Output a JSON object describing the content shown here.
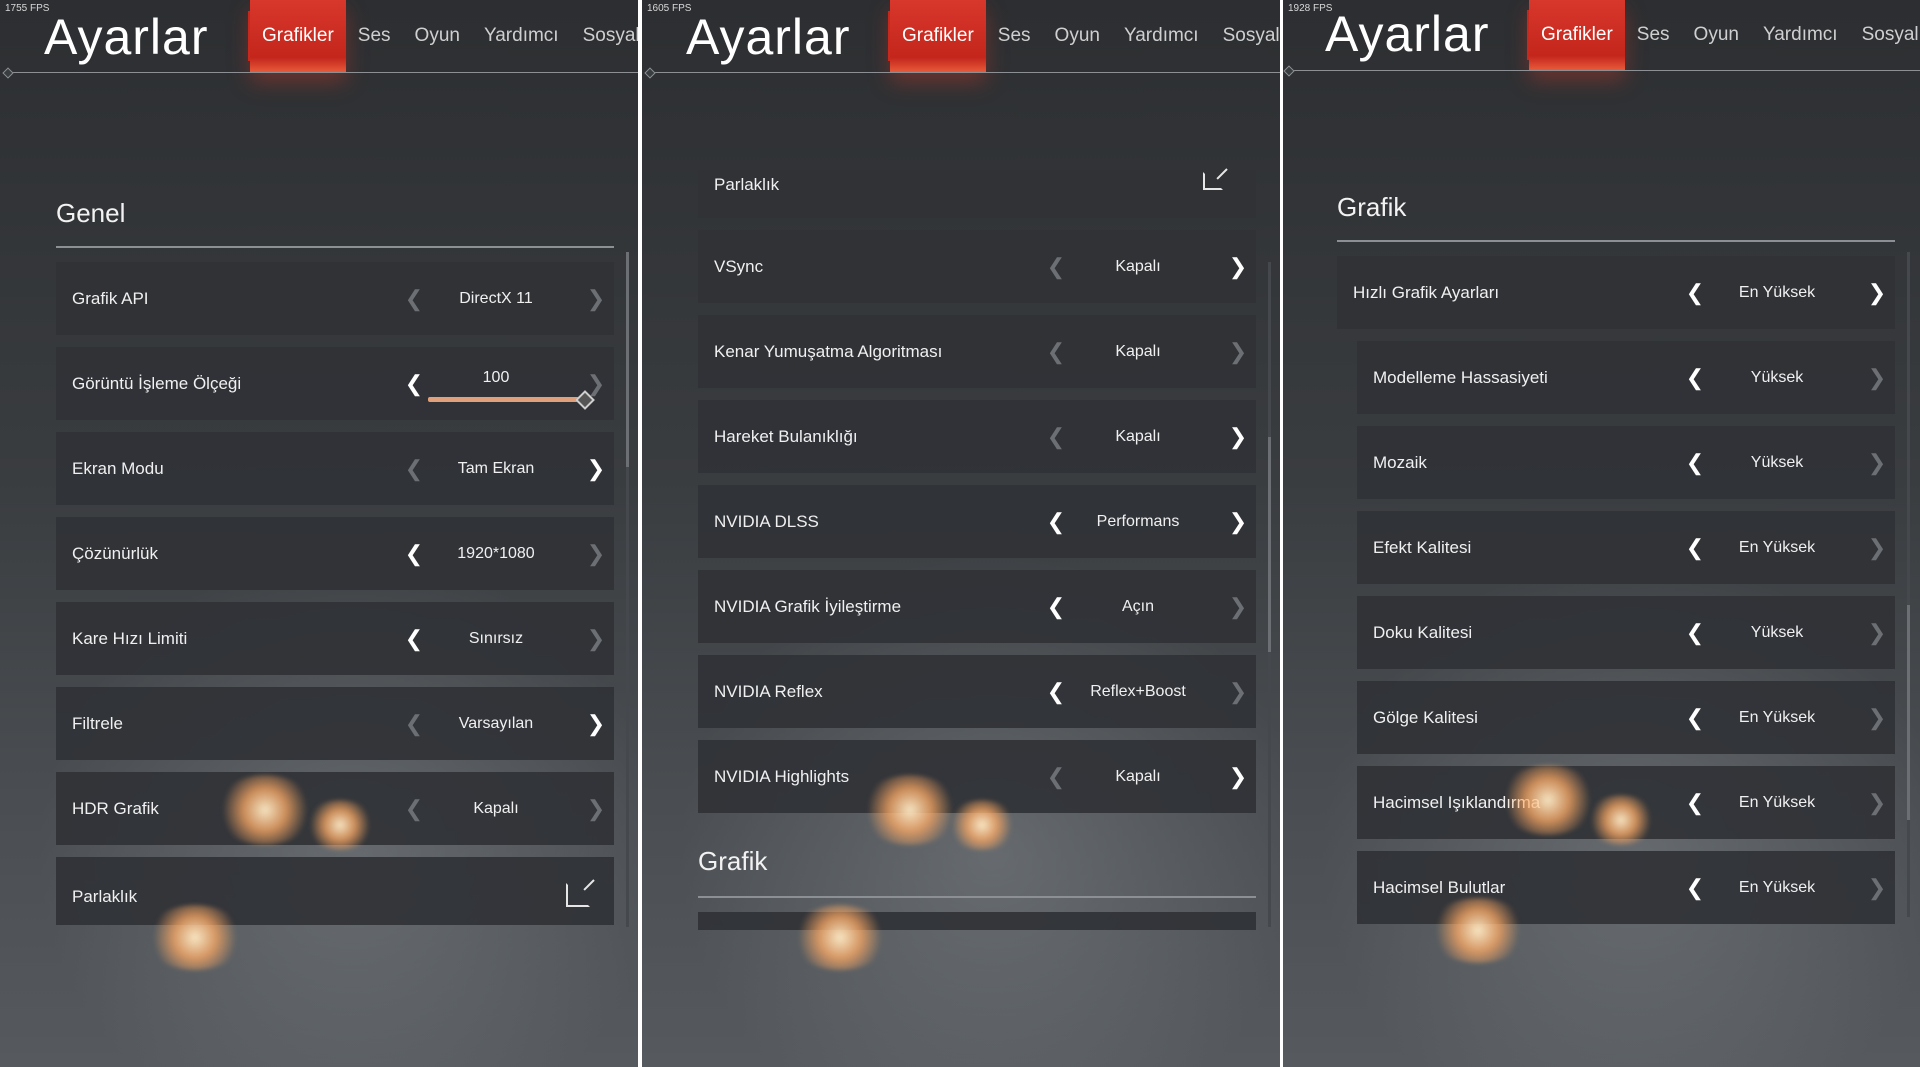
{
  "panels": [
    {
      "fps": "1755 FPS",
      "title": "Ayarlar",
      "tabs": [
        "Grafikler",
        "Ses",
        "Oyun",
        "Yardımcı",
        "Sosyal"
      ],
      "section": "Genel",
      "rows": [
        {
          "label": "Grafik API",
          "value": "DirectX 11",
          "left": "dim",
          "right": "dim"
        },
        {
          "label": "Görüntü İşleme Ölçeği",
          "value": "100",
          "left": "on",
          "right": "dim",
          "slider": 0.95
        },
        {
          "label": "Ekran Modu",
          "value": "Tam Ekran",
          "left": "dim",
          "right": "on"
        },
        {
          "label": "Çözünürlük",
          "value": "1920*1080",
          "left": "on",
          "right": "dim"
        },
        {
          "label": "Kare Hızı Limiti",
          "value": "Sınırsız",
          "left": "on",
          "right": "dim"
        },
        {
          "label": "Filtrele",
          "value": "Varsayılan",
          "left": "dim",
          "right": "on"
        },
        {
          "label": "HDR Grafik",
          "value": "Kapalı",
          "left": "dim",
          "right": "dim"
        },
        {
          "label": "Parlaklık",
          "external": true
        }
      ]
    },
    {
      "fps": "1605 FPS",
      "title": "Ayarlar",
      "tabs": [
        "Grafikler",
        "Ses",
        "Oyun",
        "Yardımcı",
        "Sosyal"
      ],
      "rows": [
        {
          "label": "Parlaklık",
          "external": true
        },
        {
          "label": "VSync",
          "value": "Kapalı",
          "left": "dim",
          "right": "on"
        },
        {
          "label": "Kenar Yumuşatma Algoritması",
          "value": "Kapalı",
          "left": "dim",
          "right": "dim"
        },
        {
          "label": "Hareket Bulanıklığı",
          "value": "Kapalı",
          "left": "dim",
          "right": "on"
        },
        {
          "label": "NVIDIA DLSS",
          "value": "Performans",
          "left": "on",
          "right": "on"
        },
        {
          "label": "NVIDIA Grafik İyileştirme",
          "value": "Açın",
          "left": "on",
          "right": "dim"
        },
        {
          "label": "NVIDIA Reflex",
          "value": "Reflex+Boost",
          "left": "on",
          "right": "dim"
        },
        {
          "label": "NVIDIA Highlights",
          "value": "Kapalı",
          "left": "dim",
          "right": "on"
        }
      ],
      "section": "Grafik"
    },
    {
      "fps": "1928 FPS",
      "title": "Ayarlar",
      "tabs": [
        "Grafikler",
        "Ses",
        "Oyun",
        "Yardımcı",
        "Sosyal"
      ],
      "section": "Grafik",
      "rows": [
        {
          "label": "Hızlı Grafik Ayarları",
          "value": "En Yüksek",
          "left": "on",
          "right": "on"
        },
        {
          "label": "Modelleme Hassasiyeti",
          "value": "Yüksek",
          "left": "on",
          "right": "dim"
        },
        {
          "label": "Mozaik",
          "value": "Yüksek",
          "left": "on",
          "right": "dim"
        },
        {
          "label": "Efekt Kalitesi",
          "value": "En Yüksek",
          "left": "on",
          "right": "dim"
        },
        {
          "label": "Doku Kalitesi",
          "value": "Yüksek",
          "left": "on",
          "right": "dim"
        },
        {
          "label": "Gölge Kalitesi",
          "value": "En Yüksek",
          "left": "on",
          "right": "dim"
        },
        {
          "label": "Hacimsel Işıklandırma",
          "value": "En Yüksek",
          "left": "on",
          "right": "dim"
        },
        {
          "label": "Hacimsel Bulutlar",
          "value": "En Yüksek",
          "left": "on",
          "right": "dim"
        }
      ]
    }
  ],
  "icons": {
    "prev": "chevron-left-icon",
    "next": "chevron-right-icon",
    "external": "external-link-icon"
  },
  "colors": {
    "accent": "#c4261c",
    "slider": "#e0a07a"
  }
}
